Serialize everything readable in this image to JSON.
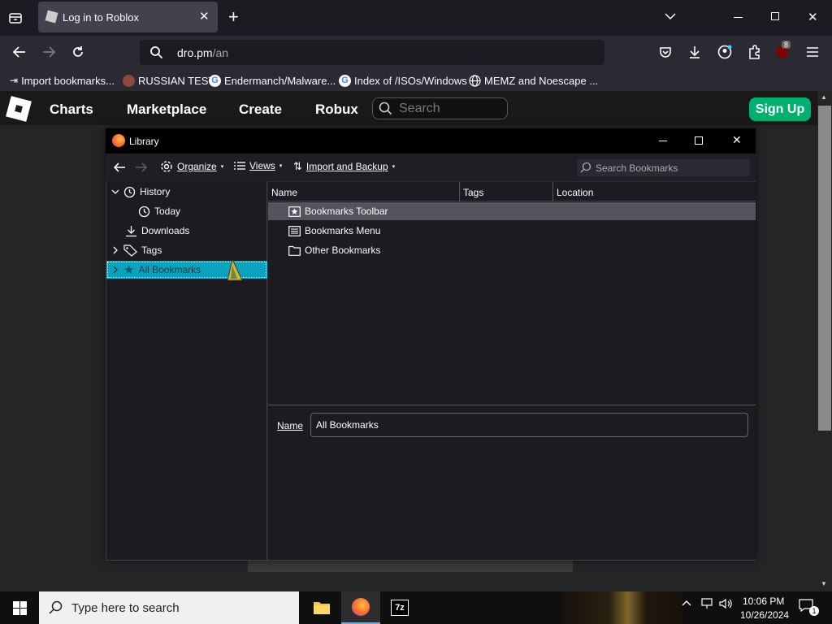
{
  "browser": {
    "tab_title": "Log in to Roblox",
    "url_domain": "dro.pm",
    "url_path": "/an",
    "extension_badge": "8",
    "bookmarks_bar": [
      {
        "label": "Import bookmarks...",
        "icon": "import-icon"
      },
      {
        "label": "RUSSIAN TEST",
        "icon": "avatar-icon"
      },
      {
        "label": "Endermanch/Malware...",
        "icon": "google-icon"
      },
      {
        "label": "Index of /ISOs/Windows",
        "icon": "google-icon"
      },
      {
        "label": "MEMZ and Noescape ...",
        "icon": "globe-icon"
      }
    ]
  },
  "roblox": {
    "nav": [
      "Charts",
      "Marketplace",
      "Create",
      "Robux"
    ],
    "search_placeholder": "Search",
    "signup_label": "Sign Up"
  },
  "library": {
    "title": "Library",
    "toolbar": {
      "organize": "Organize",
      "views": "Views",
      "import_backup": "Import and Backup",
      "search_placeholder": "Search Bookmarks"
    },
    "tree": {
      "history": "History",
      "today": "Today",
      "downloads": "Downloads",
      "tags": "Tags",
      "all_bookmarks": "All Bookmarks"
    },
    "columns": {
      "name": "Name",
      "tags": "Tags",
      "location": "Location"
    },
    "rows": [
      "Bookmarks Toolbar",
      "Bookmarks Menu",
      "Other Bookmarks"
    ],
    "detail": {
      "name_label": "Name",
      "name_value": "All Bookmarks"
    }
  },
  "taskbar": {
    "search_placeholder": "Type here to search",
    "time": "10:06 PM",
    "date": "10/26/2024",
    "notification_count": "1"
  },
  "colors": {
    "accent_signup": "#00b06f",
    "tree_selection": "#0aa3bd",
    "firefox_bg": "#1c1b22"
  }
}
